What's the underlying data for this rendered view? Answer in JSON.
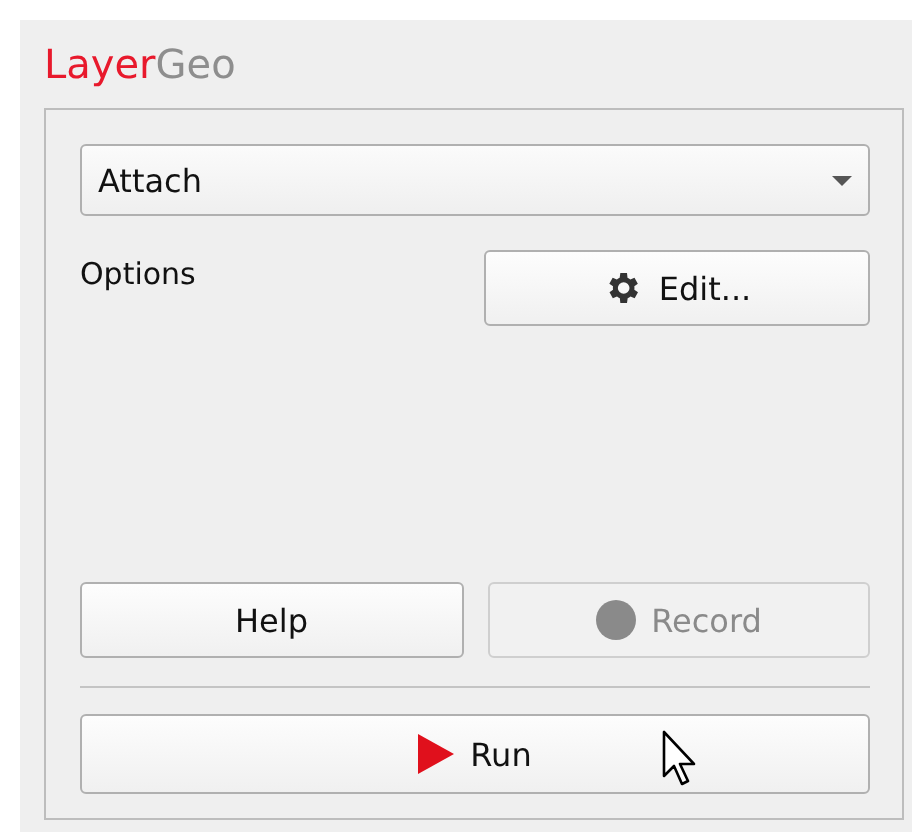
{
  "title": {
    "first": "Layer",
    "second": "Geo"
  },
  "mode_select": {
    "value": "Attach"
  },
  "options": {
    "label": "Options",
    "button": "Edit..."
  },
  "buttons": [
    {
      "label": "Help",
      "kind": "plain",
      "disabled": false
    },
    {
      "label": "Record",
      "kind": "record",
      "disabled": true
    }
  ],
  "run_button": {
    "label": "Run",
    "disabled": false
  }
}
